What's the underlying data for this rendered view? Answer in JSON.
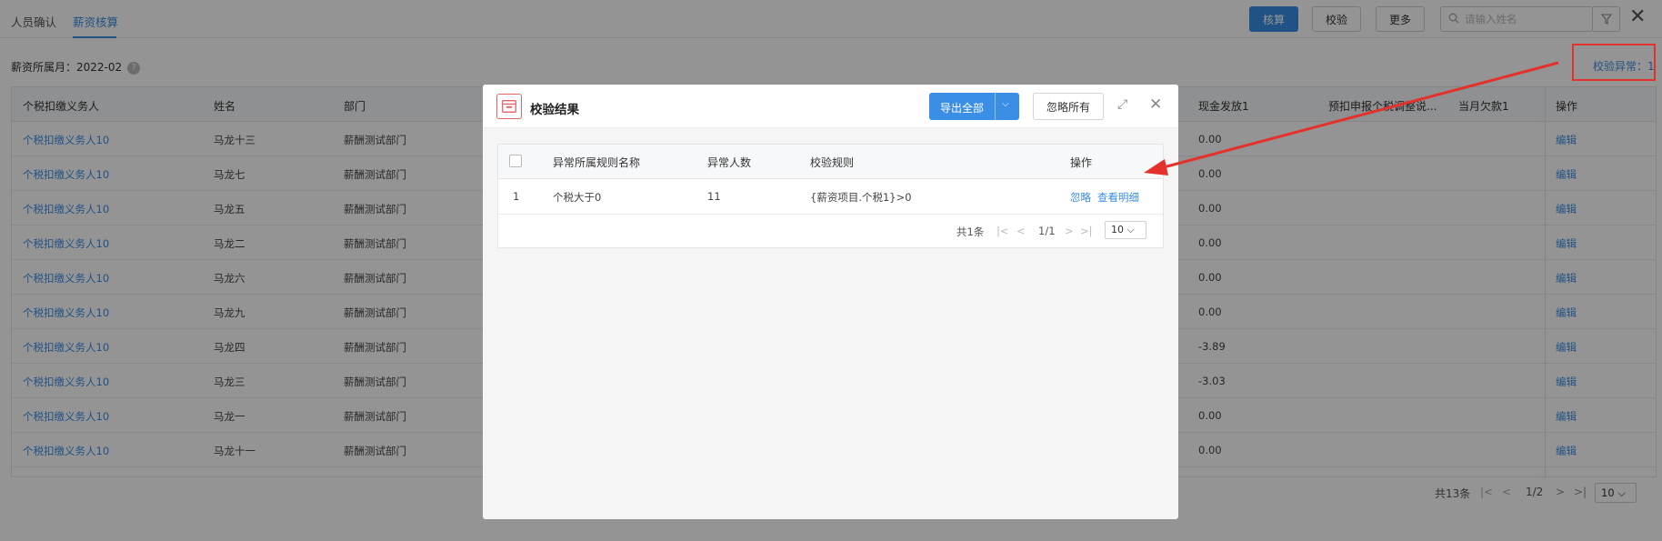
{
  "tabs": [
    {
      "label": "人员确认",
      "active": false
    },
    {
      "label": "薪资核算",
      "active": true
    }
  ],
  "toolbar": {
    "calc_label": "核算",
    "verify_label": "校验",
    "more_label": "更多",
    "search_placeholder": "请输入姓名"
  },
  "period": {
    "label": "薪资所属月：2022-02",
    "help": "?"
  },
  "anomaly_link": "校验异常：1",
  "main_table": {
    "columns": [
      {
        "label": "个税扣缴义务人"
      },
      {
        "label": "姓名"
      },
      {
        "label": "部门"
      },
      {
        "label": "现金发放1"
      },
      {
        "label": "预扣申报个税调整说..."
      },
      {
        "label": "当月欠款1"
      },
      {
        "label": "操作"
      }
    ],
    "rows": [
      {
        "withholder": "个税扣缴义务人10",
        "name": "马龙十三",
        "dept": "薪酬测试部门",
        "cash": "0.00",
        "action": "编辑"
      },
      {
        "withholder": "个税扣缴义务人10",
        "name": "马龙七",
        "dept": "薪酬测试部门",
        "cash": "0.00",
        "action": "编辑"
      },
      {
        "withholder": "个税扣缴义务人10",
        "name": "马龙五",
        "dept": "薪酬测试部门",
        "cash": "0.00",
        "action": "编辑"
      },
      {
        "withholder": "个税扣缴义务人10",
        "name": "马龙二",
        "dept": "薪酬测试部门",
        "cash": "0.00",
        "action": "编辑"
      },
      {
        "withholder": "个税扣缴义务人10",
        "name": "马龙六",
        "dept": "薪酬测试部门",
        "cash": "0.00",
        "action": "编辑"
      },
      {
        "withholder": "个税扣缴义务人10",
        "name": "马龙九",
        "dept": "薪酬测试部门",
        "cash": "0.00",
        "action": "编辑"
      },
      {
        "withholder": "个税扣缴义务人10",
        "name": "马龙四",
        "dept": "薪酬测试部门",
        "cash": "-3.89",
        "action": "编辑"
      },
      {
        "withholder": "个税扣缴义务人10",
        "name": "马龙三",
        "dept": "薪酬测试部门",
        "cash": "-3.03",
        "action": "编辑"
      },
      {
        "withholder": "个税扣缴义务人10",
        "name": "马龙一",
        "dept": "薪酬测试部门",
        "cash": "0.00",
        "action": "编辑"
      },
      {
        "withholder": "个税扣缴义务人10",
        "name": "马龙十一",
        "dept": "薪酬测试部门",
        "cash": "0.00",
        "action": "编辑"
      }
    ],
    "pagination": {
      "total": "共13条",
      "page": "1/2",
      "page_size": "10"
    }
  },
  "modal": {
    "title": "校验结果",
    "export_label": "导出全部",
    "ignore_all_label": "忽略所有",
    "columns": [
      {
        "label": "异常所属规则名称"
      },
      {
        "label": "异常人数"
      },
      {
        "label": "校验规则"
      },
      {
        "label": "操作"
      }
    ],
    "rows": [
      {
        "index": "1",
        "rule_name": "个税大于0",
        "count": "11",
        "rule": "{薪资项目.个税1}>0",
        "ignore": "忽略",
        "detail": "查看明细"
      }
    ],
    "pagination": {
      "total": "共1条",
      "page": "1/1",
      "page_size": "10"
    }
  },
  "colors": {
    "primary": "#3a8ee6",
    "annotation_red": "#e4312b"
  },
  "icons": [
    "search-icon",
    "filter-icon",
    "close-icon",
    "help-icon",
    "result-card-icon",
    "chevron-down-icon",
    "expand-icon",
    "first-page-icon",
    "prev-page-icon",
    "next-page-icon",
    "last-page-icon",
    "arrow-annotation"
  ]
}
